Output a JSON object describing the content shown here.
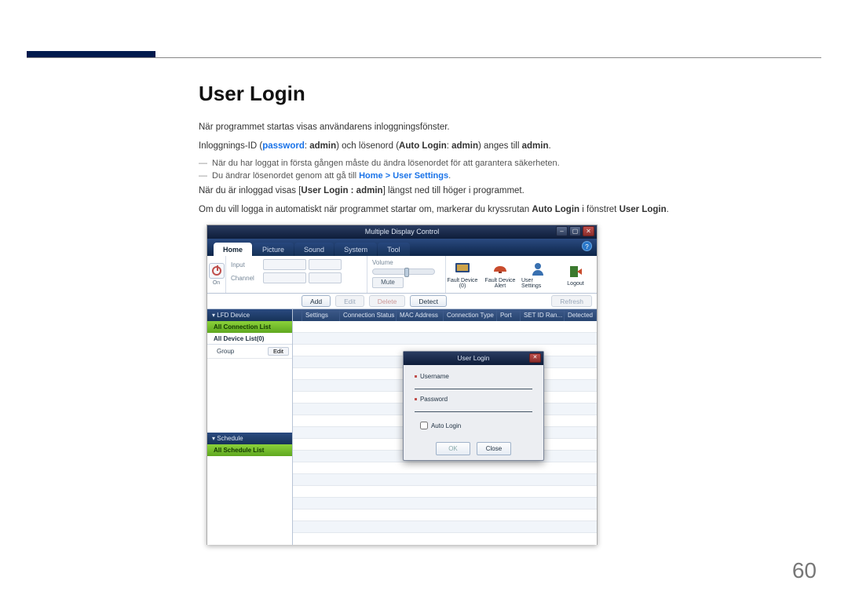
{
  "page_number": "60",
  "doc": {
    "heading": "User Login",
    "p1": "När programmet startas visas användarens inloggningsfönster.",
    "p2_a": "Inloggnings-ID (",
    "p2_pw": "password",
    "p2_b": ": ",
    "p2_admin1": "admin",
    "p2_c": ") och lösenord (",
    "p2_auto": "Auto Login",
    "p2_d": ": ",
    "p2_admin2": "admin",
    "p2_e": ") anges till ",
    "p2_admin3": "admin",
    "p2_f": ".",
    "dash1": "När du har loggat in första gången måste du ändra lösenordet för att garantera säkerheten.",
    "dash2_a": "Du ändrar lösenordet genom att gå till ",
    "dash2_link": "Home > User Settings",
    "dash2_b": ".",
    "p3_a": "När du är inloggad visas [",
    "p3_b": "User Login : admin",
    "p3_c": "] längst ned till höger i programmet.",
    "p4_a": "Om du vill logga in automatiskt när programmet startar om, markerar du kryssrutan ",
    "p4_auto": "Auto Login",
    "p4_b": " i fönstret ",
    "p4_win": "User Login",
    "p4_c": "."
  },
  "app": {
    "title": "Multiple Display Control",
    "tabs": [
      "Home",
      "Picture",
      "Sound",
      "System",
      "Tool"
    ],
    "toolbar": {
      "power_lbl": "On",
      "input_lbl": "Input",
      "channel_lbl": "Channel",
      "volume_lbl": "Volume",
      "mute": "Mute"
    },
    "ticons": {
      "fault_device": "Fault Device (0)",
      "fault_alert": "Fault Device Alert",
      "user_settings": "User Settings",
      "logout": "Logout"
    },
    "actions": {
      "add": "Add",
      "edit": "Edit",
      "delete": "Delete",
      "detect": "Detect",
      "refresh": "Refresh"
    },
    "sidebar": {
      "lfd_header": "▾  LFD Device",
      "all_conn": "All Connection List",
      "all_dev": "All Device List(0)",
      "group": "Group",
      "edit": "Edit",
      "schedule_hdr": "▾  Schedule",
      "all_sched": "All Schedule List"
    },
    "columns": [
      "",
      "Settings",
      "Connection Status",
      "MAC Address",
      "Connection Type",
      "Port",
      "SET ID Ran...",
      "Detected"
    ],
    "dialog": {
      "title": "User Login",
      "username_lbl": "Username",
      "password_lbl": "Password",
      "auto_login_lbl": "Auto Login",
      "ok": "OK",
      "close": "Close"
    }
  }
}
